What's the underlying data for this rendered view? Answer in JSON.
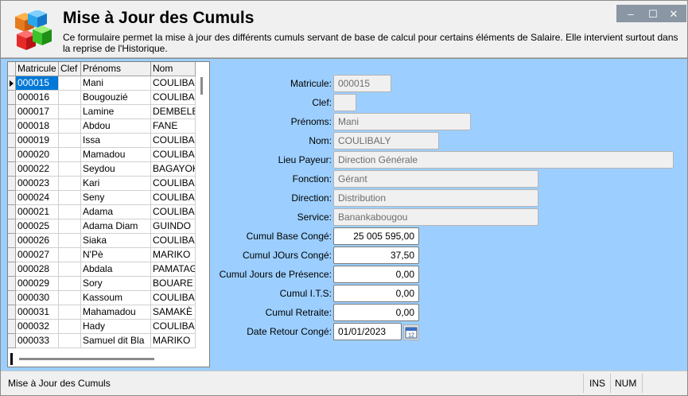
{
  "window": {
    "title": "Mise à Jour des Cumuls",
    "description": "Ce formulaire permet la mise à jour des différents cumuls servant de base de calcul pour certains éléments de Salaire. Elle intervient surtout dans la reprise de l'Historique.",
    "controls": {
      "minimize": "–",
      "maximize": "☐",
      "close": "✕"
    }
  },
  "grid": {
    "columns": [
      "Matricule",
      "Clef",
      "Prénoms",
      "Nom"
    ],
    "selected_index": 0,
    "rows": [
      {
        "matricule": "000015",
        "clef": "",
        "prenoms": "Mani",
        "nom": "COULIBA"
      },
      {
        "matricule": "000016",
        "clef": "",
        "prenoms": "Bougouzié",
        "nom": "COULIBA"
      },
      {
        "matricule": "000017",
        "clef": "",
        "prenoms": "Lamine",
        "nom": "DEMBELE"
      },
      {
        "matricule": "000018",
        "clef": "",
        "prenoms": "Abdou",
        "nom": "FANE"
      },
      {
        "matricule": "000019",
        "clef": "",
        "prenoms": "Issa",
        "nom": "COULIBA"
      },
      {
        "matricule": "000020",
        "clef": "",
        "prenoms": "Mamadou",
        "nom": "COULIBA"
      },
      {
        "matricule": "000022",
        "clef": "",
        "prenoms": "Seydou",
        "nom": "BAGAYOK"
      },
      {
        "matricule": "000023",
        "clef": "",
        "prenoms": "Kari",
        "nom": "COULIBA"
      },
      {
        "matricule": "000024",
        "clef": "",
        "prenoms": "Seny",
        "nom": "COULIBA"
      },
      {
        "matricule": "000021",
        "clef": "",
        "prenoms": "Adama",
        "nom": "COULIBA"
      },
      {
        "matricule": "000025",
        "clef": "",
        "prenoms": "Adama  Diam",
        "nom": "GUINDO"
      },
      {
        "matricule": "000026",
        "clef": "",
        "prenoms": "Siaka",
        "nom": "COULIBA"
      },
      {
        "matricule": "000027",
        "clef": "",
        "prenoms": "N'Pè",
        "nom": "MARIKO"
      },
      {
        "matricule": "000028",
        "clef": "",
        "prenoms": "Abdala",
        "nom": "PAMATAG"
      },
      {
        "matricule": "000029",
        "clef": "",
        "prenoms": "Sory",
        "nom": "BOUARE"
      },
      {
        "matricule": "000030",
        "clef": "",
        "prenoms": "Kassoum",
        "nom": "COULIBA"
      },
      {
        "matricule": "000031",
        "clef": "",
        "prenoms": "Mahamadou",
        "nom": "SAMAKÈ"
      },
      {
        "matricule": "000032",
        "clef": "",
        "prenoms": "Hady",
        "nom": "COULIBA"
      },
      {
        "matricule": "000033",
        "clef": "",
        "prenoms": "Samuel  dit Bla",
        "nom": "MARIKO"
      }
    ]
  },
  "form": {
    "matricule": {
      "label": "Matricule:",
      "value": "000015"
    },
    "clef": {
      "label": "Clef:",
      "value": ""
    },
    "prenoms": {
      "label": "Prénoms:",
      "value": "Mani"
    },
    "nom": {
      "label": "Nom:",
      "value": "COULIBALY"
    },
    "lieu_payeur": {
      "label": "Lieu Payeur:",
      "value": "Direction Générale"
    },
    "fonction": {
      "label": "Fonction:",
      "value": "Gérant"
    },
    "direction": {
      "label": "Direction:",
      "value": "Distribution"
    },
    "service": {
      "label": "Service:",
      "value": "Banankabougou"
    },
    "cumul_base_conge": {
      "label": "Cumul Base Congé:",
      "value": "25 005 595,00"
    },
    "cumul_jours_conge": {
      "label": "Cumul JOurs Congé:",
      "value": "37,50"
    },
    "cumul_jours_presence": {
      "label": "Cumul Jours de Présence:",
      "value": "0,00"
    },
    "cumul_its": {
      "label": "Cumul I.T.S:",
      "value": "0,00"
    },
    "cumul_retraite": {
      "label": "Cumul Retraite:",
      "value": "0,00"
    },
    "date_retour_conge": {
      "label": "Date Retour Congé:",
      "value": "01/01/2023",
      "calendar_icon_text": "12"
    }
  },
  "statusbar": {
    "main": "Mise à Jour des Cumuls",
    "ins": "INS",
    "num": "NUM"
  },
  "colors": {
    "content_bg": "#9ccfff",
    "selection": "#0078d7",
    "header_bg": "#f0f0f0"
  }
}
